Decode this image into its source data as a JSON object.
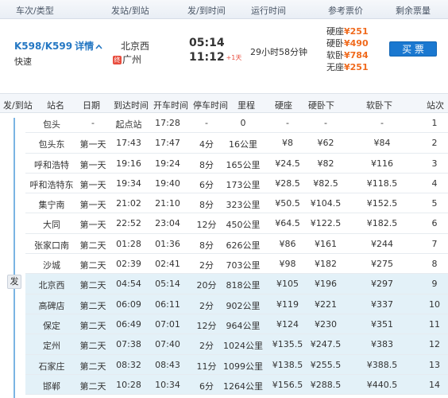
{
  "header": {
    "col_train": "车次/类型",
    "col_stations": "发站/到站",
    "col_times": "发/到时间",
    "col_duration": "运行时间",
    "col_price": "参考票价",
    "col_remaining": "剩余票量"
  },
  "train": {
    "number": "K598/K599",
    "detail_label": "详情",
    "type": "快速",
    "from_station": "北京西",
    "to_badge": "终",
    "to_station": "广州",
    "dep_time": "05:14",
    "arr_time": "11:12",
    "arr_days": "+1天",
    "duration": "29小时58分钟",
    "prices": [
      {
        "label": "硬座",
        "value": "¥251"
      },
      {
        "label": "硬卧",
        "value": "¥490"
      },
      {
        "label": "软卧",
        "value": "¥784"
      },
      {
        "label": "无座",
        "value": "¥251"
      }
    ],
    "buy_label": "买 票"
  },
  "stops_header": {
    "depart_arrive": "发/到站",
    "station": "站名",
    "day": "日期",
    "arrive_time": "到达时间",
    "depart_time": "开车时间",
    "stop_time": "停车时间",
    "distance": "里程",
    "hard_seat": "硬座",
    "hard_sleeper": "硬卧下",
    "soft_sleeper": "软卧下",
    "stop_no": "站次"
  },
  "fa_label": "发",
  "stops": [
    {
      "station": "包头",
      "day": "-",
      "arrive": "起点站",
      "depart": "17:28",
      "stop": "-",
      "distance": "0",
      "seat": "-",
      "hsleeper": "-",
      "ssleeper": "-",
      "no": "1",
      "highlight": false
    },
    {
      "station": "包头东",
      "day": "第一天",
      "arrive": "17:43",
      "depart": "17:47",
      "stop": "4分",
      "distance": "16公里",
      "seat": "¥8",
      "hsleeper": "¥62",
      "ssleeper": "¥84",
      "no": "2",
      "highlight": false
    },
    {
      "station": "呼和浩特",
      "day": "第一天",
      "arrive": "19:16",
      "depart": "19:24",
      "stop": "8分",
      "distance": "165公里",
      "seat": "¥24.5",
      "hsleeper": "¥82",
      "ssleeper": "¥116",
      "no": "3",
      "highlight": false
    },
    {
      "station": "呼和浩特东",
      "day": "第一天",
      "arrive": "19:34",
      "depart": "19:40",
      "stop": "6分",
      "distance": "173公里",
      "seat": "¥28.5",
      "hsleeper": "¥82.5",
      "ssleeper": "¥118.5",
      "no": "4",
      "highlight": false
    },
    {
      "station": "集宁南",
      "day": "第一天",
      "arrive": "21:02",
      "depart": "21:10",
      "stop": "8分",
      "distance": "323公里",
      "seat": "¥50.5",
      "hsleeper": "¥104.5",
      "ssleeper": "¥152.5",
      "no": "5",
      "highlight": false
    },
    {
      "station": "大同",
      "day": "第一天",
      "arrive": "22:52",
      "depart": "23:04",
      "stop": "12分",
      "distance": "450公里",
      "seat": "¥64.5",
      "hsleeper": "¥122.5",
      "ssleeper": "¥182.5",
      "no": "6",
      "highlight": false
    },
    {
      "station": "张家口南",
      "day": "第二天",
      "arrive": "01:28",
      "depart": "01:36",
      "stop": "8分",
      "distance": "626公里",
      "seat": "¥86",
      "hsleeper": "¥161",
      "ssleeper": "¥244",
      "no": "7",
      "highlight": false
    },
    {
      "station": "沙城",
      "day": "第二天",
      "arrive": "02:39",
      "depart": "02:41",
      "stop": "2分",
      "distance": "703公里",
      "seat": "¥98",
      "hsleeper": "¥182",
      "ssleeper": "¥275",
      "no": "8",
      "highlight": false
    },
    {
      "station": "北京西",
      "day": "第二天",
      "arrive": "04:54",
      "depart": "05:14",
      "stop": "20分",
      "distance": "818公里",
      "seat": "¥105",
      "hsleeper": "¥196",
      "ssleeper": "¥297",
      "no": "9",
      "highlight": true
    },
    {
      "station": "高碑店",
      "day": "第二天",
      "arrive": "06:09",
      "depart": "06:11",
      "stop": "2分",
      "distance": "902公里",
      "seat": "¥119",
      "hsleeper": "¥221",
      "ssleeper": "¥337",
      "no": "10",
      "highlight": true
    },
    {
      "station": "保定",
      "day": "第二天",
      "arrive": "06:49",
      "depart": "07:01",
      "stop": "12分",
      "distance": "964公里",
      "seat": "¥124",
      "hsleeper": "¥230",
      "ssleeper": "¥351",
      "no": "11",
      "highlight": true
    },
    {
      "station": "定州",
      "day": "第二天",
      "arrive": "07:38",
      "depart": "07:40",
      "stop": "2分",
      "distance": "1024公里",
      "seat": "¥135.5",
      "hsleeper": "¥247.5",
      "ssleeper": "¥383",
      "no": "12",
      "highlight": true
    },
    {
      "station": "石家庄",
      "day": "第二天",
      "arrive": "08:32",
      "depart": "08:43",
      "stop": "11分",
      "distance": "1099公里",
      "seat": "¥138.5",
      "hsleeper": "¥255.5",
      "ssleeper": "¥388.5",
      "no": "13",
      "highlight": true
    },
    {
      "station": "邯郸",
      "day": "第二天",
      "arrive": "10:28",
      "depart": "10:34",
      "stop": "6分",
      "distance": "1264公里",
      "seat": "¥156.5",
      "hsleeper": "¥288.5",
      "ssleeper": "¥440.5",
      "no": "14",
      "highlight": true
    }
  ]
}
